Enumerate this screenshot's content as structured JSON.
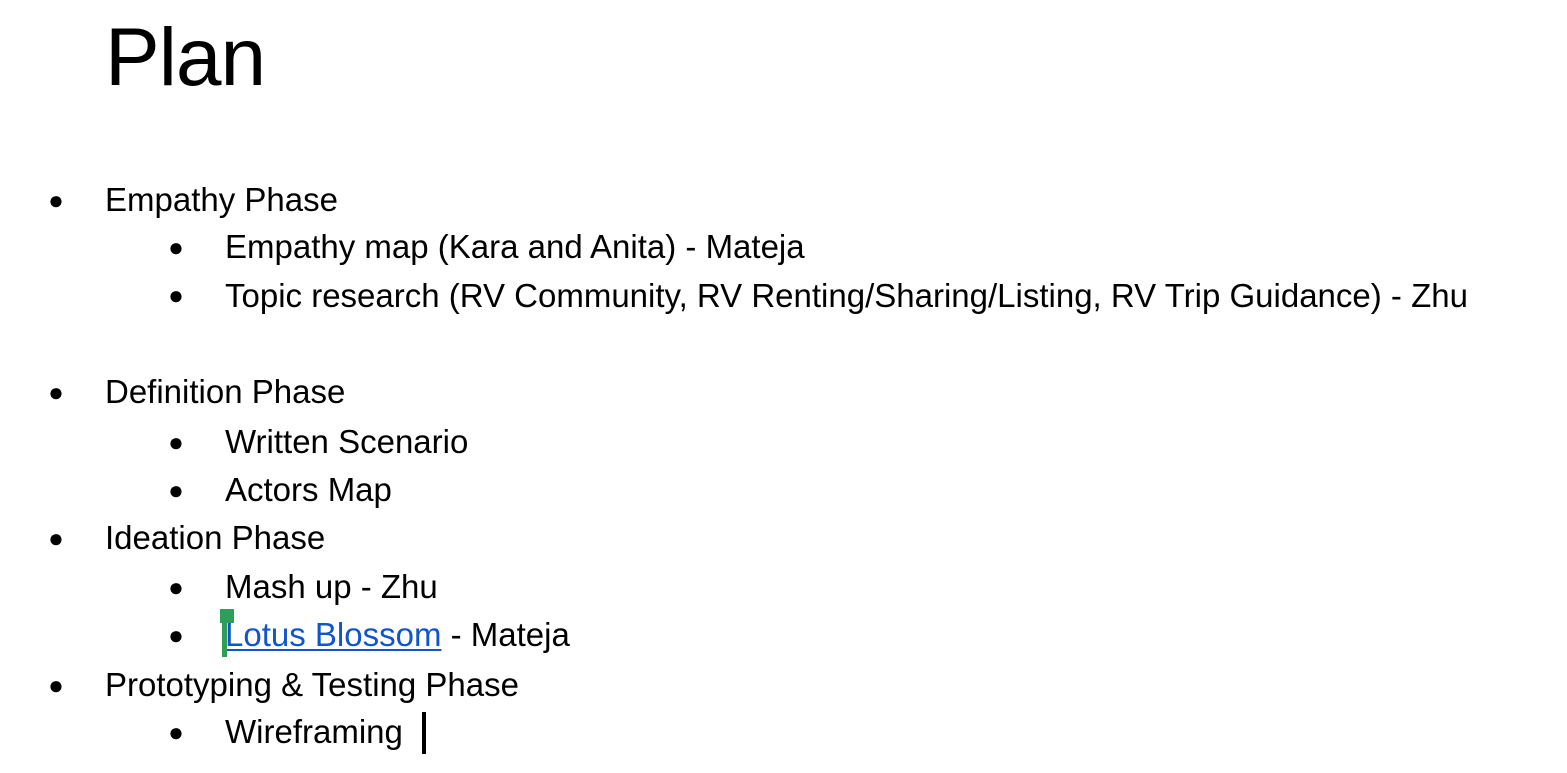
{
  "document": {
    "title": "Plan",
    "sections": [
      {
        "label": "Empathy Phase",
        "items": [
          {
            "label": "Empathy map (Kara and Anita) - Mateja"
          },
          {
            "label": "Topic research (RV Community, RV Renting/Sharing/Listing, RV Trip Guidance) - Zhu"
          }
        ]
      },
      {
        "label": "Definition Phase",
        "items": [
          {
            "label": "Written Scenario"
          },
          {
            "label": "Actors Map"
          }
        ]
      },
      {
        "label": "Ideation Phase",
        "items": [
          {
            "label": "Mash up - Zhu"
          },
          {
            "link_text": "Lotus Blossom",
            "suffix": " - Mateja"
          }
        ]
      },
      {
        "label": "Prototyping & Testing Phase",
        "items": [
          {
            "label": "Wireframing"
          }
        ]
      }
    ],
    "bullet_glyph": "●"
  },
  "colors": {
    "link": "#1155cc",
    "collaborator_cursor": "#2e9e5b",
    "text": "#000000"
  }
}
